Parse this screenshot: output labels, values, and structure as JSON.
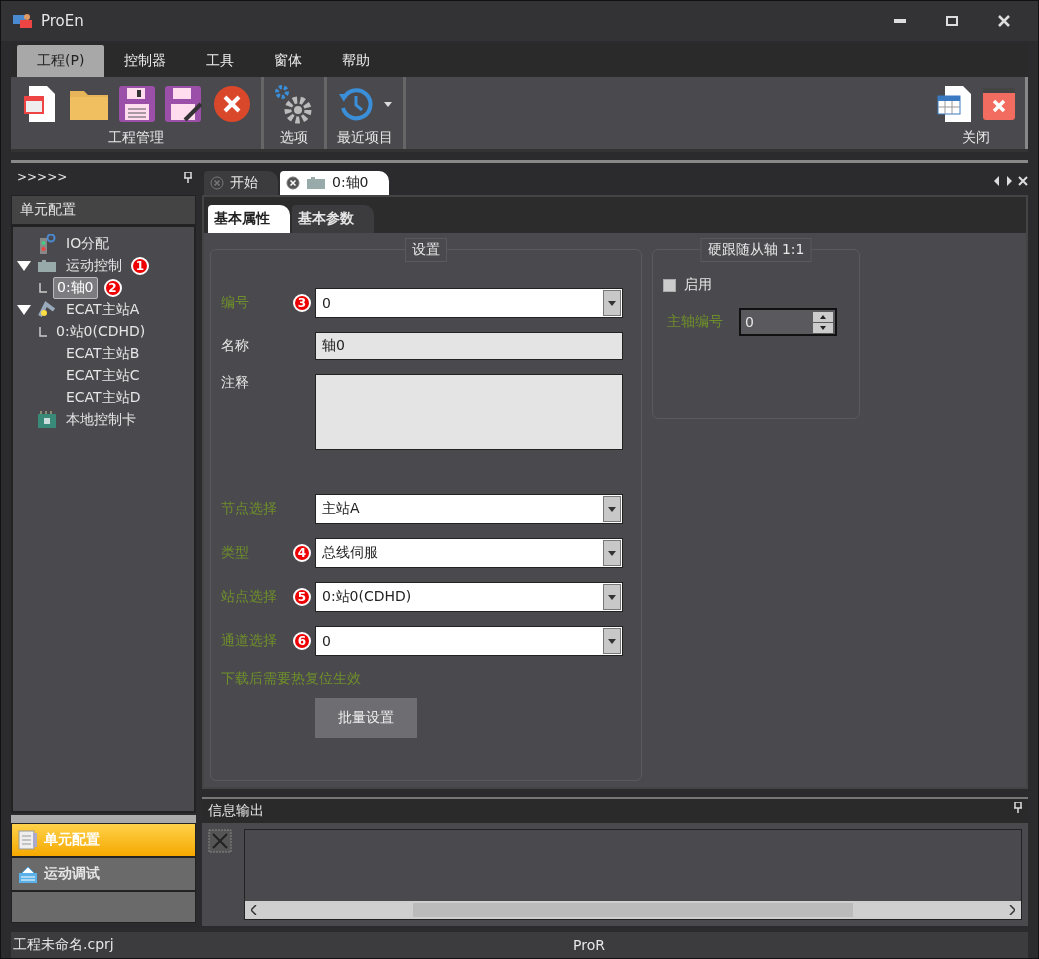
{
  "window": {
    "title": "ProEn"
  },
  "menu_tabs": [
    {
      "label": "工程(P)",
      "selected": true
    },
    {
      "label": "控制器",
      "selected": false
    },
    {
      "label": "工具",
      "selected": false
    },
    {
      "label": "窗体",
      "selected": false
    },
    {
      "label": "帮助",
      "selected": false
    }
  ],
  "ribbon_groups": [
    {
      "kind": "project",
      "label": "工程管理"
    },
    {
      "kind": "options",
      "label": "选项"
    },
    {
      "kind": "recent",
      "label": "最近项目"
    },
    {
      "kind": "close",
      "label": "关闭"
    }
  ],
  "left_panel": {
    "collapse": ">>>>>",
    "title": "单元配置",
    "tree": [
      {
        "kind": "io",
        "label": "IO分配",
        "selected": false
      },
      {
        "kind": "motion",
        "label": "运动控制",
        "selected": false,
        "expanded": true,
        "badge": "1",
        "children": [
          {
            "label": "0:轴0",
            "selected": true,
            "badge": "2"
          }
        ]
      },
      {
        "kind": "master",
        "label": "ECAT主站A",
        "selected": false,
        "expanded": true,
        "children": [
          {
            "label": "0:站0(CDHD)",
            "selected": false
          }
        ]
      },
      {
        "kind": "plain",
        "label": "ECAT主站B",
        "selected": false
      },
      {
        "kind": "plain",
        "label": "ECAT主站C",
        "selected": false
      },
      {
        "kind": "plain",
        "label": "ECAT主站D",
        "selected": false
      },
      {
        "kind": "card",
        "label": "本地控制卡",
        "selected": false
      }
    ],
    "nav": [
      {
        "kind": "config",
        "label": "单元配置",
        "selected": true
      },
      {
        "kind": "debug",
        "label": "运动调试",
        "selected": false
      }
    ]
  },
  "doc_tabs": [
    {
      "label": "开始",
      "selected": false
    },
    {
      "label": "0:轴0",
      "selected": true
    }
  ],
  "sub_tabs": [
    {
      "label": "基本属性",
      "selected": true
    },
    {
      "label": "基本参数",
      "selected": false
    }
  ],
  "settings": {
    "title": "设置",
    "fields": [
      {
        "kind": "select",
        "label": "编号",
        "color": "#6f8f2a",
        "value": "0",
        "badge": "3"
      },
      {
        "kind": "text",
        "label": "名称",
        "color": "#e6e6e6",
        "value": "轴0"
      },
      {
        "kind": "textarea",
        "label": "注释",
        "color": "#e6e6e6"
      },
      {
        "kind": "select",
        "label": "节点选择",
        "color": "#6f8f2a",
        "value": "主站A"
      },
      {
        "kind": "select",
        "label": "类型",
        "color": "#6f8f2a",
        "value": "总线伺服",
        "badge": "4"
      },
      {
        "kind": "select",
        "label": "站点选择",
        "color": "#6f8f2a",
        "value": "0:站0(CDHD)",
        "badge": "5"
      },
      {
        "kind": "select",
        "label": "通道选择",
        "color": "#6f8f2a",
        "value": "0",
        "badge": "6"
      }
    ],
    "note": "下载后需要热复位生效",
    "button": "批量设置"
  },
  "follow": {
    "title": "硬跟随从轴 1:1",
    "enable": {
      "label": "启用",
      "checked": false
    },
    "spin": {
      "label": "主轴编号",
      "value": "0"
    }
  },
  "output": {
    "title": "信息输出"
  },
  "status_bar": {
    "file": "工程未命名.cprj",
    "center": "ProR"
  }
}
